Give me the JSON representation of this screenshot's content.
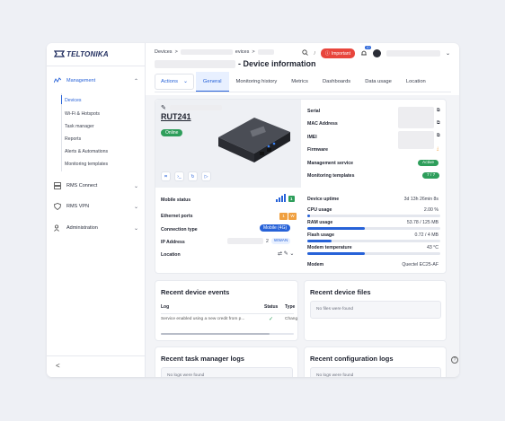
{
  "brand": {
    "logo_text": "TELTONIKA",
    "accent": "#2762d8",
    "success": "#2e9e5b",
    "danger": "#e8453c"
  },
  "sidebar": {
    "groups": [
      {
        "label": "Management",
        "icon": "chart-icon",
        "expanded": true
      },
      {
        "label": "RMS Connect",
        "icon": "server-icon",
        "expanded": false
      },
      {
        "label": "RMS VPN",
        "icon": "shield-icon",
        "expanded": false
      },
      {
        "label": "Administration",
        "icon": "users-icon",
        "expanded": false
      }
    ],
    "items": [
      "Devices",
      "Wi-Fi & Hotspots",
      "Task manager",
      "Reports",
      "Alerts & Automations",
      "Monitoring templates"
    ],
    "collapse_label": "<"
  },
  "header": {
    "breadcrumb_1": "Devices",
    "breadcrumb_sep": ">",
    "breadcrumb_2": "evices",
    "breadcrumb_3": ">",
    "title": "- Device information",
    "important_label": "Important",
    "bell_badge": "10"
  },
  "tabs": {
    "actions_label": "Actions",
    "items": [
      "General",
      "Monitoring history",
      "Metrics",
      "Dashboards",
      "Data usage",
      "Location"
    ]
  },
  "device": {
    "model": "RUT241",
    "status": "Online",
    "left_rows": {
      "mobile_status_label": "Mobile status",
      "mobile_status_value": "1",
      "ethernet_label": "Ethernet ports",
      "eth_1": "1",
      "eth_2": "W",
      "connection_label": "Connection type",
      "connection_value": "Mobile (4G)",
      "ip_label": "IP Address",
      "ip_suffix": "2",
      "ip_badge": "WWAN",
      "location_label": "Location"
    },
    "info": {
      "serial_label": "Serial",
      "mac_label": "MAC Address",
      "imei_label": "IMEI",
      "firmware_label": "Firmware",
      "mgmt_label": "Management service",
      "mgmt_value": "Active",
      "templates_label": "Monitoring templates",
      "templates_value": "7 / 7"
    },
    "stats": {
      "uptime_label": "Device uptime",
      "uptime_value": "3d 13h 26min 8s",
      "cpu_label": "CPU usage",
      "cpu_value": "2.00 %",
      "cpu_fraction": 0.02,
      "ram_label": "RAM usage",
      "ram_value": "53.78 / 125 MB",
      "ram_fraction": 0.43,
      "flash_label": "Flash usage",
      "flash_value": "0.72 / 4 MB",
      "flash_fraction": 0.18,
      "temp_label": "Modem temperature",
      "temp_value": "43 °C",
      "temp_fraction": 0.43,
      "modem_label": "Modem",
      "modem_value": "Quectel EC25-AF"
    }
  },
  "events": {
    "title": "Recent device events",
    "col_log": "Log",
    "col_status": "Status",
    "col_type": "Type",
    "row_log": "Service enabled using a new credit from p...",
    "row_type": "Chang"
  },
  "files": {
    "title": "Recent device files",
    "empty": "No files were found"
  },
  "task_logs": {
    "title": "Recent task manager logs",
    "empty": "No logs were found"
  },
  "config_logs": {
    "title": "Recent configuration logs",
    "empty": "No logs were found"
  }
}
